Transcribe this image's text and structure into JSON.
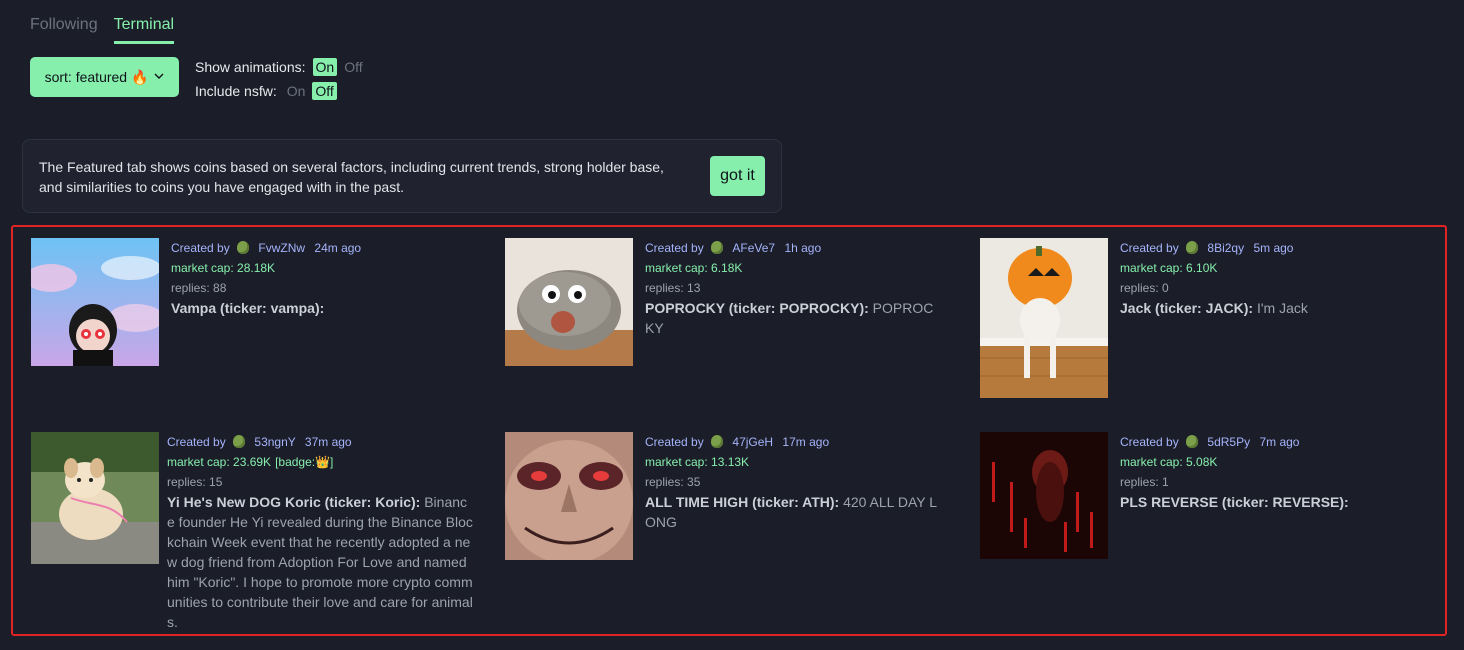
{
  "tabs": [
    {
      "label": "Following"
    },
    {
      "label": "Terminal"
    }
  ],
  "sort": {
    "label": "sort: featured 🔥"
  },
  "toggles": {
    "animations_label": "Show animations:",
    "nsfw_label": "Include nsfw:",
    "on": "On",
    "off": "Off",
    "animations_value": "On",
    "nsfw_value": "Off"
  },
  "notice": {
    "text": "The Featured tab shows coins based on several factors, including current trends, strong holder base, and similarities to coins you have engaged with in the past.",
    "button": "got it"
  },
  "coins": [
    {
      "created_by": "Created by",
      "creator": "FvwZNw",
      "time": "24m ago",
      "market_cap": "market cap: 28.18K",
      "badge": "",
      "replies": "replies: 88",
      "title": "Vampa (ticker: vampa):",
      "description": ""
    },
    {
      "created_by": "Created by",
      "creator": "AFeVe7",
      "time": "1h ago",
      "market_cap": "market cap: 6.18K",
      "badge": "",
      "replies": "replies: 13",
      "title": "POPROCKY (ticker: POPROCKY):",
      "description": "POPROCKY"
    },
    {
      "created_by": "Created by",
      "creator": "8Bi2qy",
      "time": "5m ago",
      "market_cap": "market cap: 6.10K",
      "badge": "",
      "replies": "replies: 0",
      "title": "Jack (ticker: JACK):",
      "description": "I'm Jack"
    },
    {
      "created_by": "Created by",
      "creator": "53ngnY",
      "time": "37m ago",
      "market_cap": "market cap: 23.69K",
      "badge": "[badge:👑]",
      "replies": "replies: 15",
      "title": "Yi He's New DOG Koric (ticker: Koric):",
      "description": "Binance founder He Yi revealed during the Binance Blockchain Week event that he recently adopted a new dog friend from Adoption For Love and named him \"Koric\". I hope to promote more crypto communities to contribute their love and care for animals."
    },
    {
      "created_by": "Created by",
      "creator": "47jGeH",
      "time": "17m ago",
      "market_cap": "market cap: 13.13K",
      "badge": "",
      "replies": "replies: 35",
      "title": "ALL TIME HIGH (ticker: ATH):",
      "description": "420 ALL DAY LONG"
    },
    {
      "created_by": "Created by",
      "creator": "5dR5Py",
      "time": "7m ago",
      "market_cap": "market cap: 5.08K",
      "badge": "",
      "replies": "replies: 1",
      "title": "PLS REVERSE (ticker: REVERSE):",
      "description": ""
    }
  ]
}
